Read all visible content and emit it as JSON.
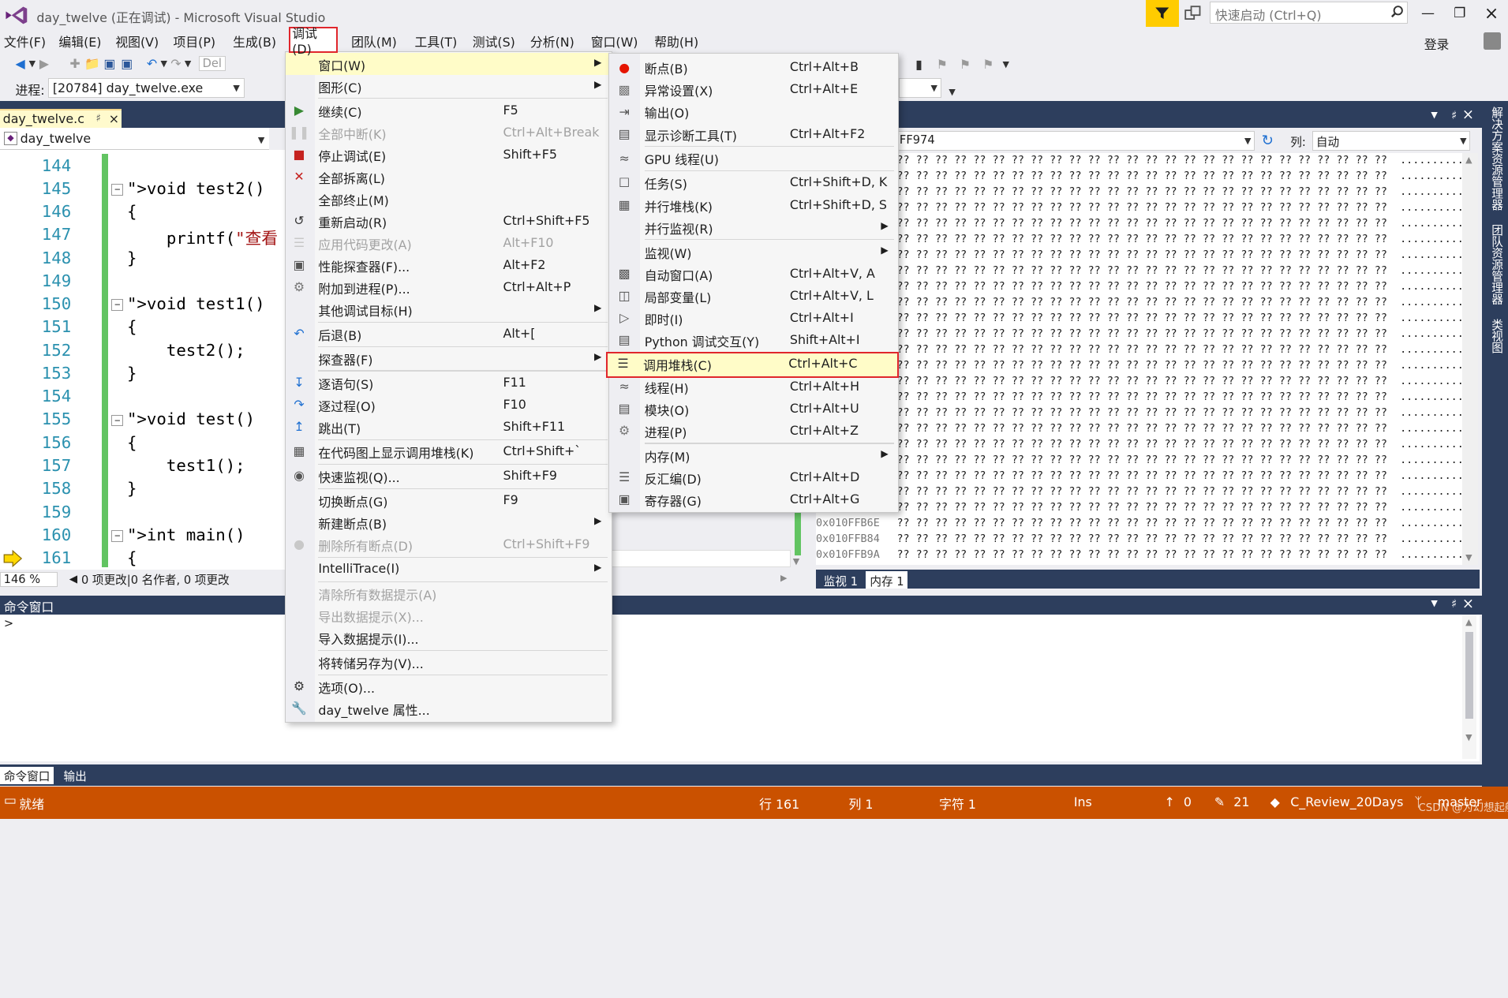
{
  "window": {
    "title": "day_twelve (正在调试) - Microsoft Visual Studio",
    "quick_launch_placeholder": "快速启动 (Ctrl+Q)",
    "login": "登录"
  },
  "menubar": [
    "文件(F)",
    "编辑(E)",
    "视图(V)",
    "项目(P)",
    "生成(B)",
    "调试(D)",
    "团队(M)",
    "工具(T)",
    "测试(S)",
    "分析(N)",
    "窗口(W)",
    "帮助(H)"
  ],
  "toolbar": {
    "process_label": "进程:",
    "process_value": "[20784] day_twelve.exe",
    "config_partial": "Del"
  },
  "editor": {
    "tab": "day_twelve.c",
    "nav": "day_twelve",
    "zoom": "146 %",
    "codelens": "0 项更改|0 名作者, 0 项更改",
    "lines": [
      {
        "n": "144",
        "code": ""
      },
      {
        "n": "145",
        "code": "void test2()"
      },
      {
        "n": "146",
        "code": "{"
      },
      {
        "n": "147",
        "code": "    printf(\"查看"
      },
      {
        "n": "148",
        "code": "}"
      },
      {
        "n": "149",
        "code": ""
      },
      {
        "n": "150",
        "code": "void test1()"
      },
      {
        "n": "151",
        "code": "{"
      },
      {
        "n": "152",
        "code": "    test2();"
      },
      {
        "n": "153",
        "code": "}"
      },
      {
        "n": "154",
        "code": ""
      },
      {
        "n": "155",
        "code": "void test()"
      },
      {
        "n": "156",
        "code": "{"
      },
      {
        "n": "157",
        "code": "    test1();"
      },
      {
        "n": "158",
        "code": "}"
      },
      {
        "n": "159",
        "code": ""
      },
      {
        "n": "160",
        "code": "int main()"
      },
      {
        "n": "161",
        "code": "{"
      }
    ]
  },
  "debug_menu": [
    {
      "label": "窗口(W)",
      "shortcut": "",
      "submenu": true,
      "icon": "",
      "disabled": false,
      "highlight": true
    },
    {
      "label": "图形(C)",
      "shortcut": "",
      "submenu": true,
      "icon": "",
      "disabled": false,
      "sep_after": true
    },
    {
      "label": "继续(C)",
      "shortcut": "F5",
      "icon": "play-icon",
      "disabled": false
    },
    {
      "label": "全部中断(K)",
      "shortcut": "Ctrl+Alt+Break",
      "icon": "pause-icon",
      "disabled": true
    },
    {
      "label": "停止调试(E)",
      "shortcut": "Shift+F5",
      "icon": "stop-icon",
      "disabled": false
    },
    {
      "label": "全部拆离(L)",
      "shortcut": "",
      "icon": "detach-icon",
      "disabled": false
    },
    {
      "label": "全部终止(M)",
      "shortcut": "",
      "icon": "",
      "disabled": false
    },
    {
      "label": "重新启动(R)",
      "shortcut": "Ctrl+Shift+F5",
      "icon": "restart-icon",
      "disabled": false
    },
    {
      "label": "应用代码更改(A)",
      "shortcut": "Alt+F10",
      "icon": "apply-code-icon",
      "disabled": true
    },
    {
      "label": "性能探查器(F)...",
      "shortcut": "Alt+F2",
      "icon": "profiler-icon",
      "disabled": false
    },
    {
      "label": "附加到进程(P)...",
      "shortcut": "Ctrl+Alt+P",
      "icon": "attach-icon",
      "disabled": false
    },
    {
      "label": "其他调试目标(H)",
      "shortcut": "",
      "submenu": true,
      "icon": "",
      "disabled": false,
      "sep_after": true
    },
    {
      "label": "后退(B)",
      "shortcut": "Alt+[",
      "icon": "step-back-icon",
      "disabled": false,
      "sep_after": true
    },
    {
      "label": "探查器(F)",
      "shortcut": "",
      "submenu": true,
      "icon": "",
      "disabled": false,
      "sep_after": true
    },
    {
      "label": "逐语句(S)",
      "shortcut": "F11",
      "icon": "step-into-icon",
      "disabled": false
    },
    {
      "label": "逐过程(O)",
      "shortcut": "F10",
      "icon": "step-over-icon",
      "disabled": false
    },
    {
      "label": "跳出(T)",
      "shortcut": "Shift+F11",
      "icon": "step-out-icon",
      "disabled": false,
      "sep_after": true
    },
    {
      "label": "在代码图上显示调用堆栈(K)",
      "shortcut": "Ctrl+Shift+`",
      "icon": "code-map-icon",
      "disabled": false,
      "sep_after": true
    },
    {
      "label": "快速监视(Q)...",
      "shortcut": "Shift+F9",
      "icon": "quickwatch-icon",
      "disabled": false,
      "sep_after": true
    },
    {
      "label": "切换断点(G)",
      "shortcut": "F9",
      "icon": "",
      "disabled": false
    },
    {
      "label": "新建断点(B)",
      "shortcut": "",
      "submenu": true,
      "icon": "",
      "disabled": false
    },
    {
      "label": "删除所有断点(D)",
      "shortcut": "Ctrl+Shift+F9",
      "icon": "delete-breakpoints-icon",
      "disabled": true,
      "sep_after": true
    },
    {
      "label": "IntelliTrace(I)",
      "shortcut": "",
      "submenu": true,
      "icon": "",
      "disabled": false,
      "sep_after": true
    },
    {
      "label": "清除所有数据提示(A)",
      "shortcut": "",
      "icon": "",
      "disabled": true
    },
    {
      "label": "导出数据提示(X)...",
      "shortcut": "",
      "icon": "",
      "disabled": true
    },
    {
      "label": "导入数据提示(I)...",
      "shortcut": "",
      "icon": "",
      "disabled": false,
      "sep_after": true
    },
    {
      "label": "将转储另存为(V)...",
      "shortcut": "",
      "icon": "",
      "disabled": false,
      "sep_after": true
    },
    {
      "label": "选项(O)...",
      "shortcut": "",
      "icon": "gear-icon",
      "disabled": false
    },
    {
      "label": "day_twelve 属性...",
      "shortcut": "",
      "icon": "wrench-icon",
      "disabled": false
    }
  ],
  "window_submenu": [
    {
      "label": "断点(B)",
      "shortcut": "Ctrl+Alt+B",
      "icon": "breakpoint-icon"
    },
    {
      "label": "异常设置(X)",
      "shortcut": "Ctrl+Alt+E",
      "icon": "exception-icon"
    },
    {
      "label": "输出(O)",
      "shortcut": "",
      "icon": "output-icon"
    },
    {
      "label": "显示诊断工具(T)",
      "shortcut": "Ctrl+Alt+F2",
      "icon": "diagnostics-icon",
      "sep_after": true
    },
    {
      "label": "GPU 线程(U)",
      "shortcut": "",
      "icon": "gpu-thread-icon",
      "sep_after": true
    },
    {
      "label": "任务(S)",
      "shortcut": "Ctrl+Shift+D, K",
      "icon": "task-icon"
    },
    {
      "label": "并行堆栈(K)",
      "shortcut": "Ctrl+Shift+D, S",
      "icon": "parallel-stacks-icon"
    },
    {
      "label": "并行监视(R)",
      "shortcut": "",
      "submenu": true,
      "icon": "",
      "sep_after": true
    },
    {
      "label": "监视(W)",
      "shortcut": "",
      "submenu": true,
      "icon": ""
    },
    {
      "label": "自动窗口(A)",
      "shortcut": "Ctrl+Alt+V, A",
      "icon": "autos-icon"
    },
    {
      "label": "局部变量(L)",
      "shortcut": "Ctrl+Alt+V, L",
      "icon": "locals-icon"
    },
    {
      "label": "即时(I)",
      "shortcut": "Ctrl+Alt+I",
      "icon": "immediate-icon"
    },
    {
      "label": "Python 调试交互(Y)",
      "shortcut": "Shift+Alt+I",
      "icon": "python-icon",
      "sep_after": true
    },
    {
      "label": "调用堆栈(C)",
      "shortcut": "Ctrl+Alt+C",
      "icon": "call-stack-icon",
      "highlight": true
    },
    {
      "label": "线程(H)",
      "shortcut": "Ctrl+Alt+H",
      "icon": "threads-icon"
    },
    {
      "label": "模块(O)",
      "shortcut": "Ctrl+Alt+U",
      "icon": "modules-icon"
    },
    {
      "label": "进程(P)",
      "shortcut": "Ctrl+Alt+Z",
      "icon": "processes-icon",
      "sep_after": true
    },
    {
      "label": "内存(M)",
      "shortcut": "",
      "submenu": true,
      "icon": ""
    },
    {
      "label": "反汇编(D)",
      "shortcut": "Ctrl+Alt+D",
      "icon": "disassembly-icon"
    },
    {
      "label": "寄存器(G)",
      "shortcut": "Ctrl+Alt+G",
      "icon": "registers-icon"
    }
  ],
  "memory": {
    "address_partial": "FF974",
    "columns_label": "列:",
    "columns_value": "自动",
    "cell": "??",
    "visible_addresses": [
      "0x010FFB6E",
      "0x010FFB84",
      "0x010FFB9A"
    ],
    "tabs": [
      "监视 1",
      "内存 1"
    ]
  },
  "command_window": {
    "title": "命令窗口",
    "tabs": [
      "命令窗口",
      "输出"
    ]
  },
  "right_tabs": [
    "解决方案资源管理器",
    "团队资源管理器",
    "类视图"
  ],
  "status": {
    "ready": "就绪",
    "line": "行 161",
    "col": "列 1",
    "char": "字符 1",
    "ins": "Ins",
    "up": "0",
    "edits": "21",
    "repo": "C_Review_20Days",
    "branch": "master",
    "watermark": "CSDN @为幻想起航"
  },
  "colors": {
    "statusbar": "#ca5100",
    "accent_dark": "#2d3e5d",
    "highlight_box": "#e0262c",
    "menu_highlight": "#fffcc8"
  }
}
